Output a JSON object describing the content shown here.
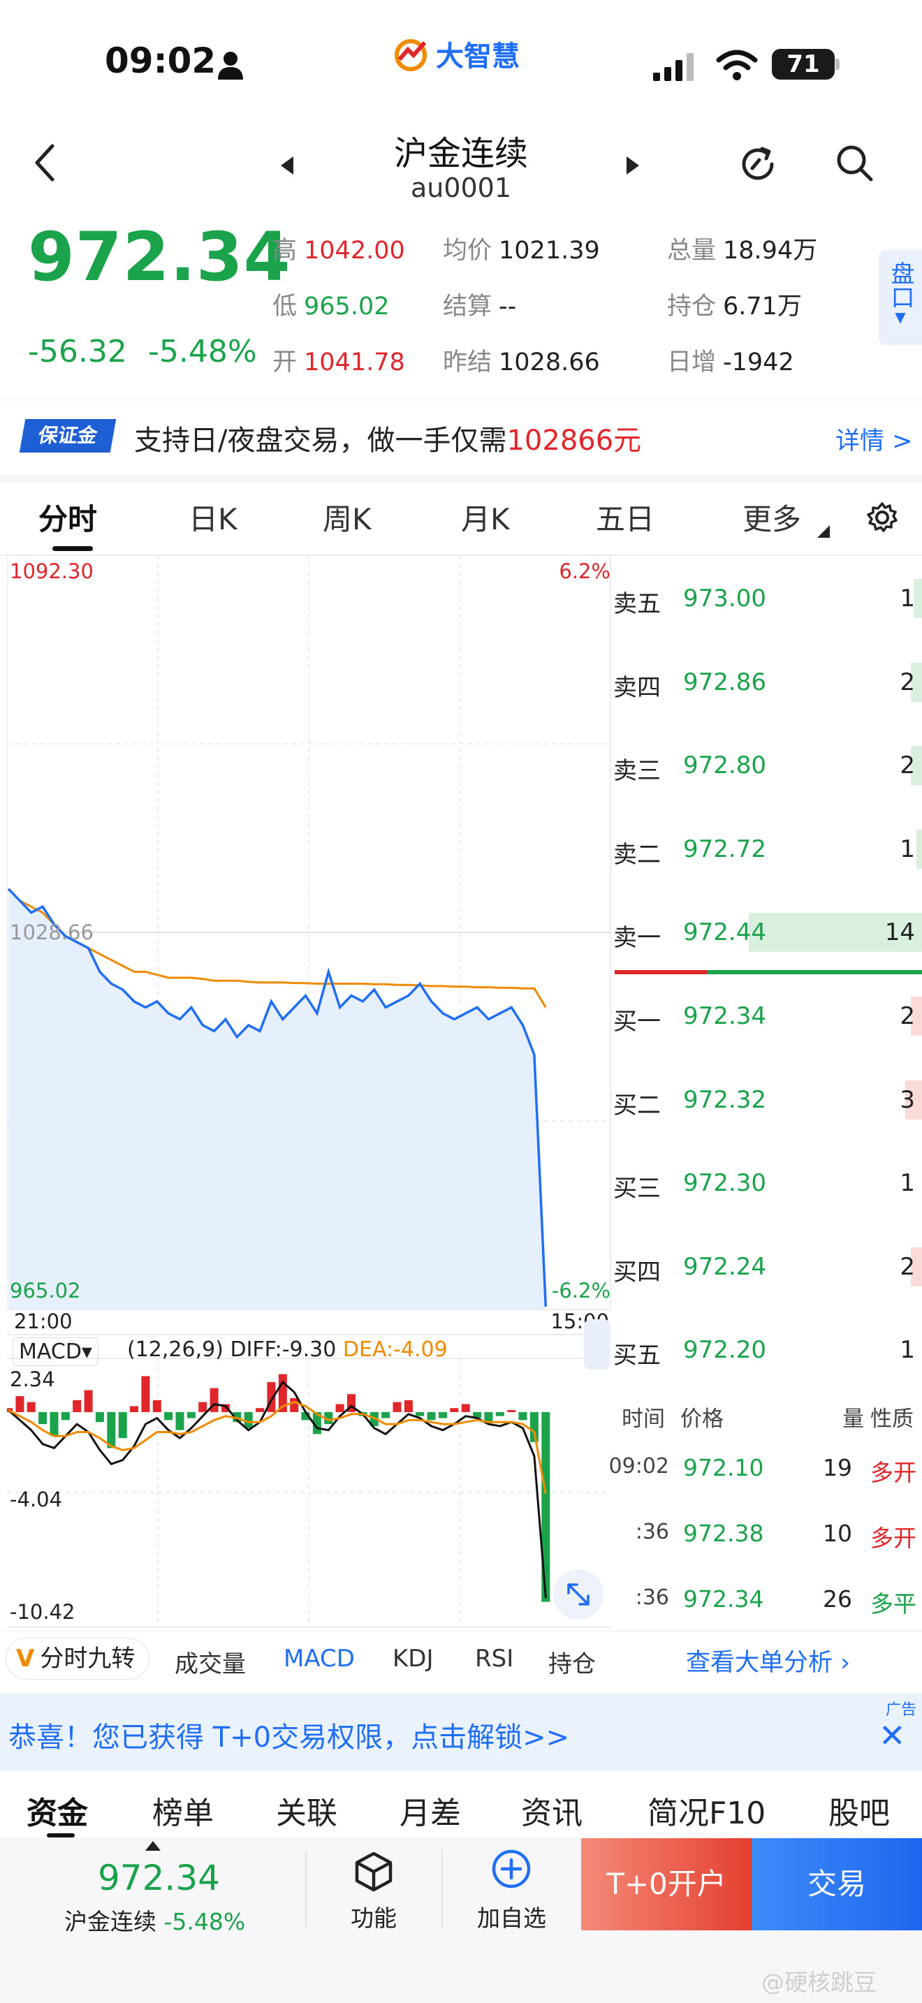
{
  "status": {
    "time": "09:02",
    "battery": "71",
    "brand": "大智慧"
  },
  "header": {
    "title": "沪金连续",
    "code": "au0001"
  },
  "quote": {
    "price": "972.34",
    "change": "-56.32",
    "change_pct": "-5.48%",
    "stats": [
      {
        "label": "高",
        "value": "1042.00",
        "color": "red"
      },
      {
        "label": "均价",
        "value": "1021.39",
        "color": "dark"
      },
      {
        "label": "总量",
        "value": "18.94万",
        "color": "dark"
      },
      {
        "label": "低",
        "value": "965.02",
        "color": "green"
      },
      {
        "label": "结算",
        "value": "--",
        "color": "dark"
      },
      {
        "label": "持仓",
        "value": "6.71万",
        "color": "dark"
      },
      {
        "label": "开",
        "value": "1041.78",
        "color": "red"
      },
      {
        "label": "昨结",
        "value": "1028.66",
        "color": "dark"
      },
      {
        "label": "日增",
        "value": "-1942",
        "color": "dark"
      }
    ],
    "pankou_label": "盘口"
  },
  "banner": {
    "badge": "保证金",
    "text": "支持日/夜盘交易，做一手仅需",
    "amount": "102866元",
    "detail": "详情 >"
  },
  "tabs": [
    "分时",
    "日K",
    "周K",
    "月K",
    "五日",
    "更多"
  ],
  "chart_data": {
    "type": "line",
    "ylim": [
      965.02,
      1092.3
    ],
    "pct_range": [
      "6.2%",
      "-6.2%"
    ],
    "y_top_label": "1092.30",
    "y_mid_label": "1028.66",
    "y_bottom_label": "965.02",
    "pct_top_label": "6.2%",
    "pct_bottom_label": "-6.2%",
    "x_start_label": "21:00",
    "x_end_label": "15:00",
    "series": [
      {
        "values": [
          1036,
          1034,
          1032,
          1033,
          1030,
          1028,
          1027,
          1026,
          1022,
          1020,
          1019,
          1017,
          1016,
          1017,
          1015,
          1014,
          1016,
          1013,
          1012,
          1014,
          1011,
          1013,
          1012,
          1017,
          1014,
          1016,
          1018,
          1015,
          1022,
          1016,
          1018,
          1017,
          1019,
          1016,
          1017,
          1018,
          1020,
          1017,
          1015,
          1014,
          1015,
          1016,
          1014,
          1015,
          1016,
          1013,
          1008,
          965.5
        ]
      },
      {
        "values": [
          1036,
          1034,
          1033,
          1032,
          1030,
          1028,
          1027,
          1026,
          1025,
          1024,
          1023,
          1022,
          1022,
          1021.5,
          1021,
          1021,
          1021,
          1020.8,
          1020.5,
          1020.5,
          1020.5,
          1020.3,
          1020.2,
          1020.2,
          1020.2,
          1020.1,
          1020.1,
          1020,
          1020,
          1020,
          1020,
          1020,
          1019.9,
          1019.9,
          1019.8,
          1019.8,
          1019.7,
          1019.6,
          1019.6,
          1019.5,
          1019.5,
          1019.4,
          1019.4,
          1019.3,
          1019.3,
          1019.2,
          1019.2,
          1016
        ]
      }
    ]
  },
  "macd": {
    "name": "MACD▾",
    "params": "(12,26,9)",
    "diff": "DIFF:-9.30",
    "dea": "DEA:-4.09",
    "y_top": "2.34",
    "y_mid": "-4.04",
    "y_bottom": "-10.42",
    "ylim": [
      -10.42,
      2.34
    ],
    "hist": [
      0.2,
      0.8,
      0.5,
      -0.6,
      -1.2,
      -0.4,
      0.6,
      1.1,
      -0.5,
      -1.8,
      -1.3,
      0.3,
      1.8,
      0.6,
      -0.4,
      -0.9,
      -0.3,
      0.5,
      1.2,
      0.4,
      -0.5,
      -0.8,
      0.2,
      1.5,
      1.9,
      0.7,
      -0.4,
      -1.1,
      -0.6,
      0.4,
      0.9,
      -0.2,
      -0.7,
      -0.3,
      0.5,
      0.6,
      -0.2,
      -0.4,
      -0.3,
      0.2,
      0.4,
      -0.3,
      -0.5,
      -0.2,
      0.1,
      -0.4,
      -1.5,
      -9.5
    ],
    "diff_values": [
      0.1,
      -0.4,
      -0.9,
      -1.6,
      -1.8,
      -1.2,
      -0.6,
      -1.0,
      -1.9,
      -2.6,
      -2.4,
      -1.7,
      -0.6,
      -0.3,
      -0.9,
      -1.3,
      -0.8,
      -0.2,
      0.4,
      0.3,
      -0.4,
      -0.9,
      -0.5,
      0.6,
      1.5,
      1.0,
      0.0,
      -0.8,
      -0.9,
      -0.2,
      0.3,
      -0.1,
      -0.8,
      -1.1,
      -0.6,
      -0.1,
      -0.3,
      -0.7,
      -0.9,
      -0.6,
      -0.2,
      -0.3,
      -0.6,
      -0.7,
      -0.5,
      -0.8,
      -2.2,
      -9.3
    ],
    "dea_values": [
      0.1,
      -0.2,
      -0.5,
      -0.9,
      -1.2,
      -1.2,
      -1.0,
      -1.0,
      -1.3,
      -1.7,
      -1.9,
      -1.8,
      -1.4,
      -1.0,
      -1.0,
      -1.1,
      -1.0,
      -0.7,
      -0.4,
      -0.2,
      -0.3,
      -0.5,
      -0.5,
      -0.2,
      0.3,
      0.5,
      0.3,
      -0.1,
      -0.4,
      -0.3,
      -0.1,
      -0.1,
      -0.3,
      -0.6,
      -0.6,
      -0.4,
      -0.4,
      -0.5,
      -0.6,
      -0.6,
      -0.5,
      -0.4,
      -0.5,
      -0.5,
      -0.5,
      -0.6,
      -1.0,
      -4.09
    ]
  },
  "orderbook": {
    "asks": [
      {
        "label": "卖五",
        "price": "973.00",
        "vol": "1",
        "bar": 0.03
      },
      {
        "label": "卖四",
        "price": "972.86",
        "vol": "2",
        "bar": 0.04
      },
      {
        "label": "卖三",
        "price": "972.80",
        "vol": "2",
        "bar": 0.04
      },
      {
        "label": "卖二",
        "price": "972.72",
        "vol": "1",
        "bar": 0.02
      },
      {
        "label": "卖一",
        "price": "972.44",
        "vol": "14",
        "bar": 0.62
      }
    ],
    "bids": [
      {
        "label": "买一",
        "price": "972.34",
        "vol": "2",
        "bar": 0.04
      },
      {
        "label": "买二",
        "price": "972.32",
        "vol": "3",
        "bar": 0.06
      },
      {
        "label": "买三",
        "price": "972.30",
        "vol": "1",
        "bar": 0.0
      },
      {
        "label": "买四",
        "price": "972.24",
        "vol": "2",
        "bar": 0.04
      },
      {
        "label": "买五",
        "price": "972.20",
        "vol": "1",
        "bar": 0.0
      }
    ],
    "buy_ratio": 0.3
  },
  "ticks": {
    "headers": {
      "time": "时间",
      "price": "价格",
      "vol": "量",
      "type": "性质"
    },
    "rows": [
      {
        "time": "09:02",
        "price": "972.10",
        "vol": "19",
        "type": "多开",
        "color": "red"
      },
      {
        "time": ":36",
        "price": "972.38",
        "vol": "10",
        "type": "多开",
        "color": "red"
      },
      {
        "time": ":36",
        "price": "972.34",
        "vol": "26",
        "type": "多平",
        "color": "green"
      }
    ]
  },
  "indicator_tabs": [
    "分时九转",
    "成交量",
    "MACD",
    "KDJ",
    "RSI",
    "持仓"
  ],
  "big_order_link": "查看大单分析 ›",
  "ad": {
    "text": "恭喜！您已获得 T+0交易权限，点击解锁>>",
    "tag": "广告"
  },
  "bottom_tabs": [
    "资金",
    "榜单",
    "关联",
    "月差",
    "资讯",
    "简况F10",
    "股吧"
  ],
  "bottom_bar": {
    "price": "972.34",
    "name": "沪金连续",
    "pct": "-5.48%",
    "function_label": "功能",
    "watchlist_label": "加自选",
    "open_account": "T+0开户",
    "trade": "交易"
  },
  "watermark": "@硬核跳豆",
  "colors": {
    "up": "#e0262b",
    "down": "#1aa34a",
    "accent": "#1f6ef5",
    "price_line": "#1f6ef5",
    "avg_line": "#f08a00"
  }
}
